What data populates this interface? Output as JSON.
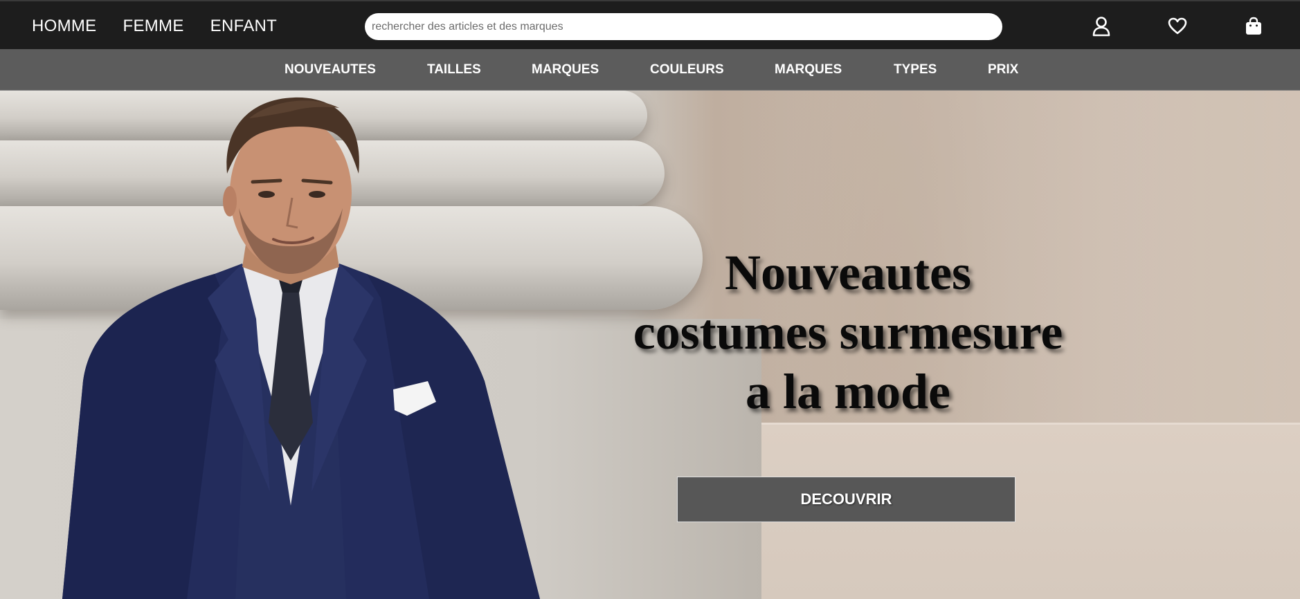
{
  "header": {
    "gender_nav": [
      "HOMME",
      "FEMME",
      "ENFANT"
    ],
    "search": {
      "placeholder": "rechercher des articles et des marques",
      "value": ""
    },
    "icons": [
      "user-icon",
      "heart-icon",
      "shopping-bag-icon"
    ]
  },
  "category_nav": [
    "NOUVEAUTES",
    "TAILLES",
    "MARQUES",
    "COULEURS",
    "MARQUES",
    "TYPES",
    "PRIX"
  ],
  "hero": {
    "title_lines": [
      "Nouveautes",
      "costumes surmesure",
      "a la mode"
    ],
    "cta_label": "DECOUVRIR"
  },
  "colors": {
    "topbar": "#1d1d1d",
    "catbar": "#5c5c5c",
    "cta_bg": "#575757",
    "suit_navy": "#232c5c"
  }
}
